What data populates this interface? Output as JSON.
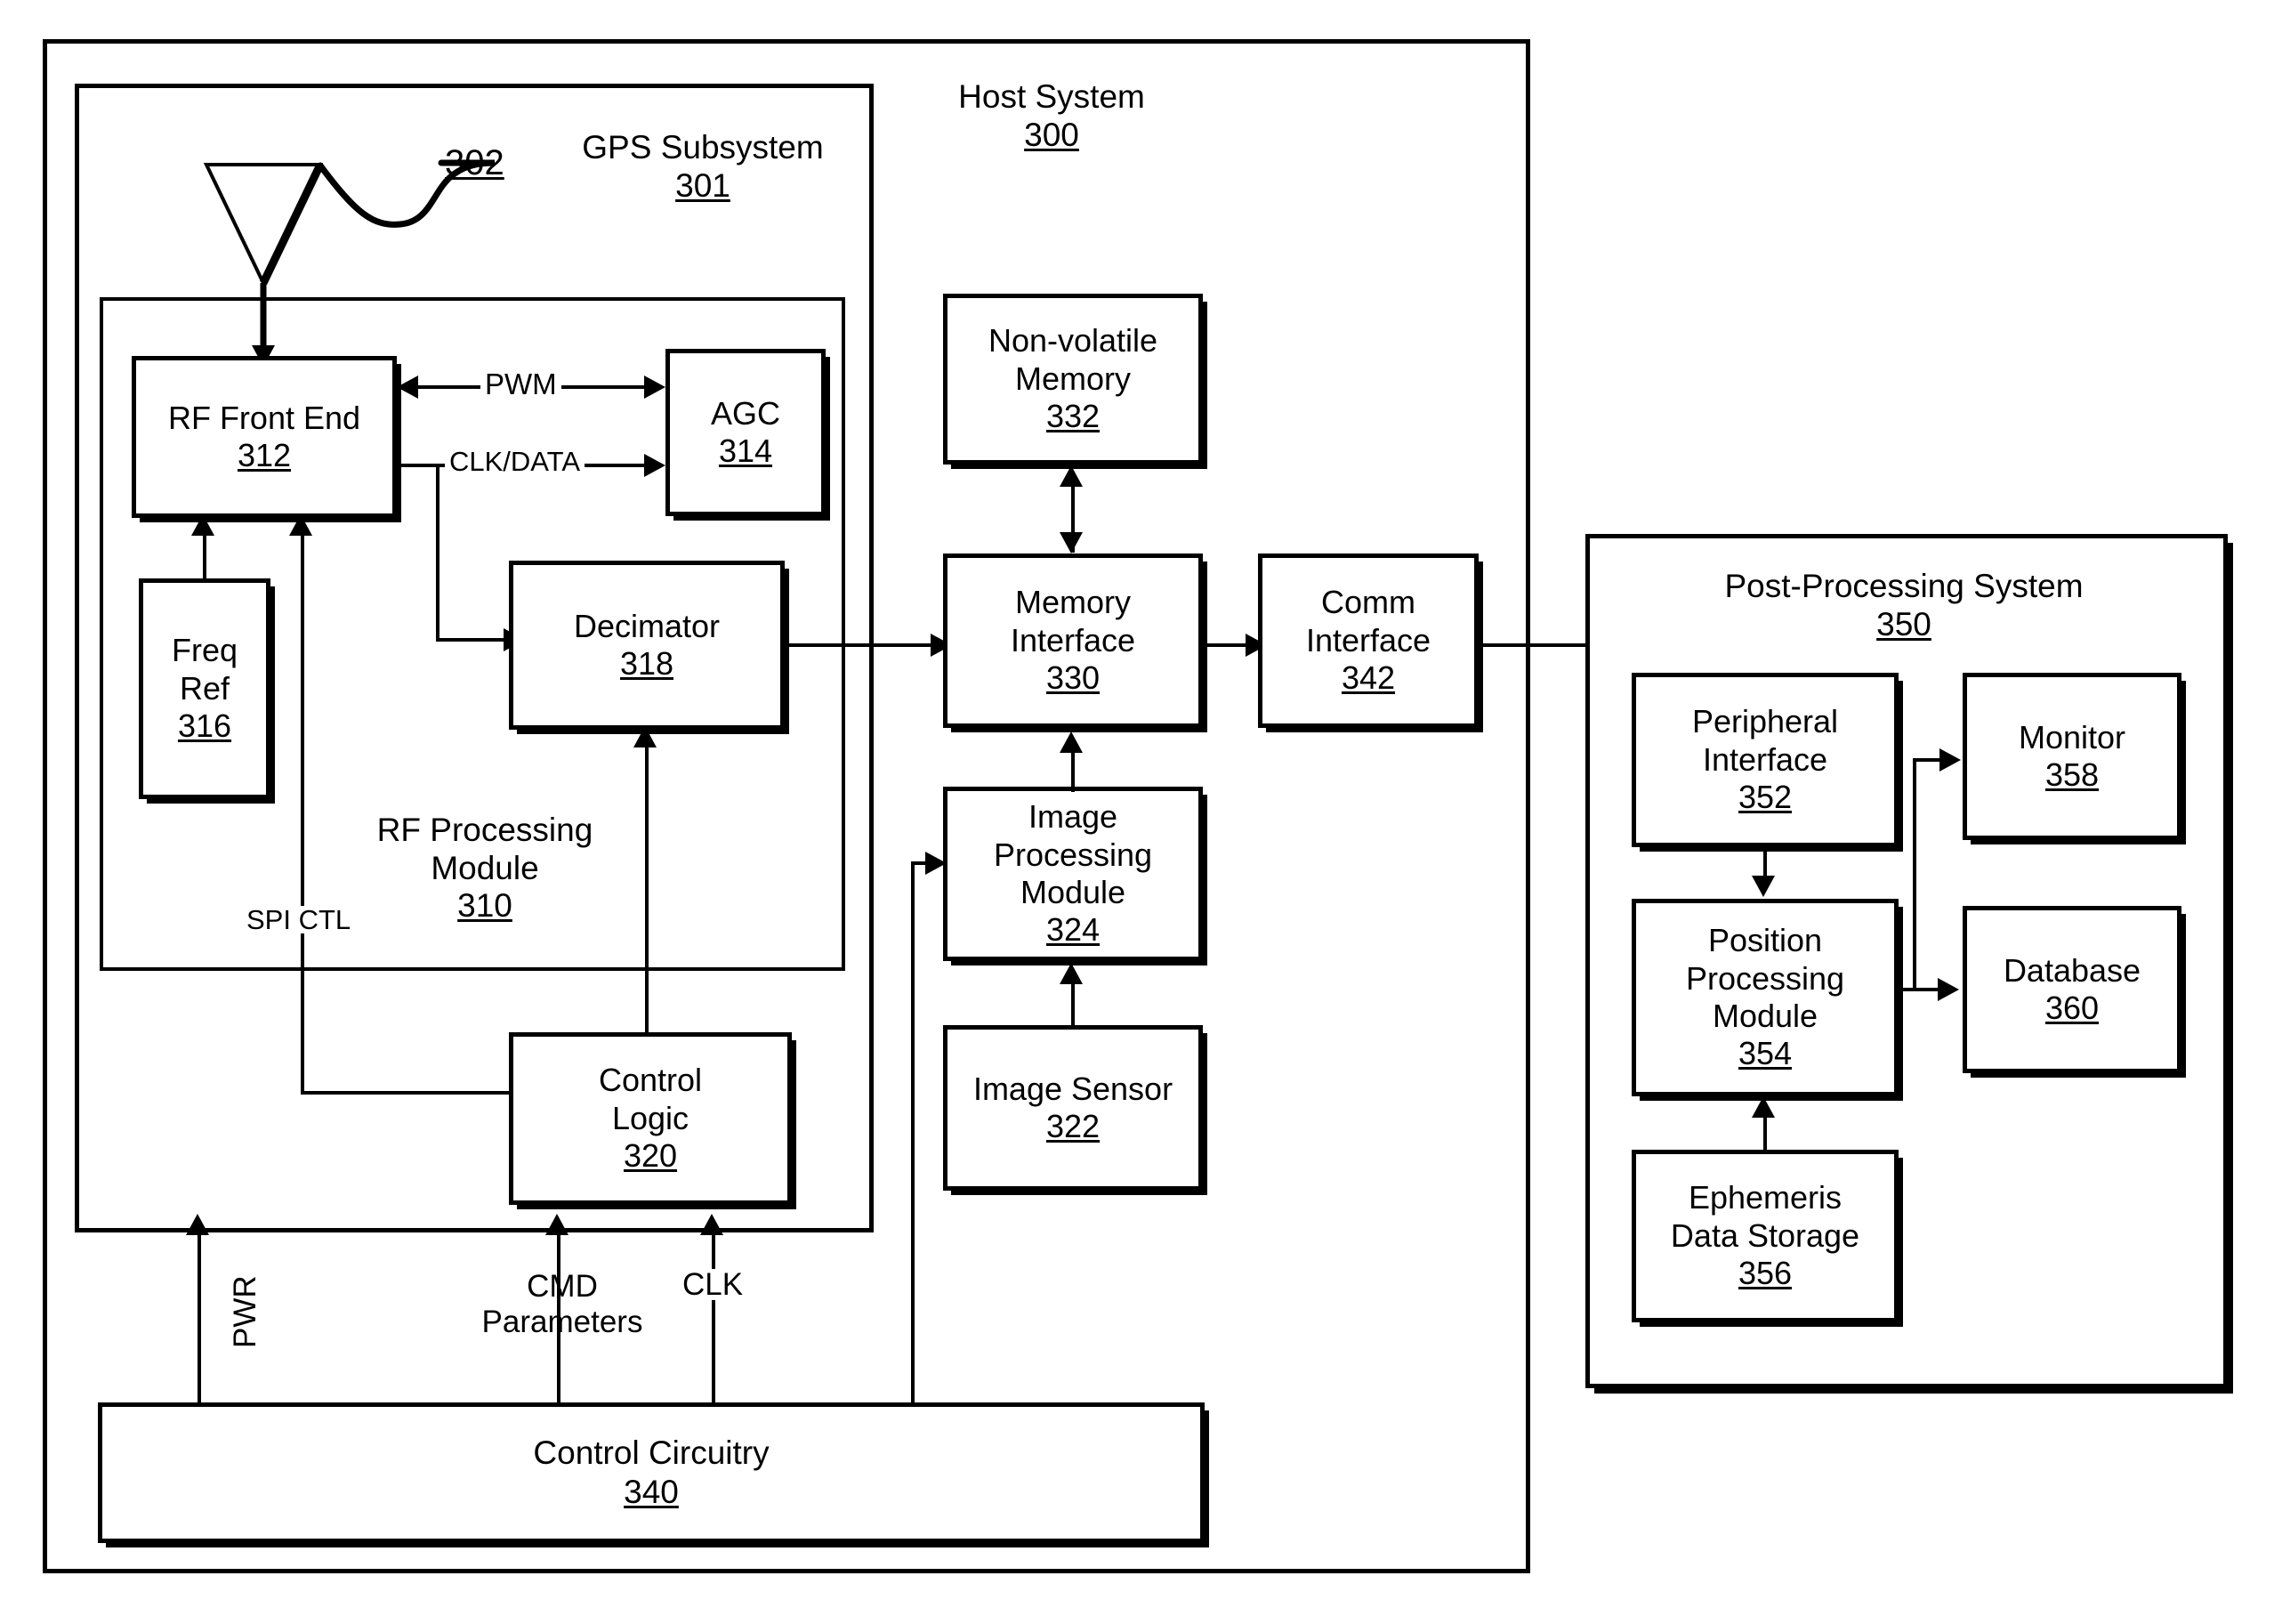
{
  "figure": {
    "host_system": {
      "title": "Host System",
      "ref": "300"
    },
    "gps_subsystem": {
      "title": "GPS Subsystem",
      "ref": "301"
    },
    "antenna": {
      "ref": "302"
    },
    "rf_processing_module": {
      "title_line1": "RF Processing",
      "title_line2": "Module",
      "ref": "310"
    },
    "post_processing_system": {
      "title": "Post-Processing System",
      "ref": "350"
    }
  },
  "blocks": {
    "rf_front_end": {
      "line1": "RF Front End",
      "ref": "312"
    },
    "agc": {
      "line1": "AGC",
      "ref": "314"
    },
    "freq_ref": {
      "line1": "Freq",
      "line2": "Ref",
      "ref": "316"
    },
    "decimator": {
      "line1": "Decimator",
      "ref": "318"
    },
    "control_logic": {
      "line1": "Control",
      "line2": "Logic",
      "ref": "320"
    },
    "image_sensor": {
      "line1": "Image Sensor",
      "ref": "322"
    },
    "image_processing_module": {
      "line1": "Image",
      "line2": "Processing",
      "line3": "Module",
      "ref": "324"
    },
    "memory_interface": {
      "line1": "Memory",
      "line2": "Interface",
      "ref": "330"
    },
    "non_volatile_memory": {
      "line1": "Non-volatile",
      "line2": "Memory",
      "ref": "332"
    },
    "comm_interface": {
      "line1": "Comm",
      "line2": "Interface",
      "ref": "342"
    },
    "control_circuitry": {
      "line1": "Control Circuitry",
      "ref": "340"
    },
    "peripheral_interface": {
      "line1": "Peripheral",
      "line2": "Interface",
      "ref": "352"
    },
    "position_processing_module": {
      "line1": "Position",
      "line2": "Processing",
      "line3": "Module",
      "ref": "354"
    },
    "ephemeris_data_storage": {
      "line1": "Ephemeris",
      "line2": "Data Storage",
      "ref": "356"
    },
    "monitor": {
      "line1": "Monitor",
      "ref": "358"
    },
    "database": {
      "line1": "Database",
      "ref": "360"
    }
  },
  "signals": {
    "pwm": "PWM",
    "clk_data": "CLK/DATA",
    "spi_ctl": "SPI CTL",
    "pwr": "PWR",
    "cmd": "CMD",
    "parameters": "Parameters",
    "clk": "CLK"
  },
  "colors": {
    "ink": "#000000",
    "paper": "#ffffff"
  }
}
